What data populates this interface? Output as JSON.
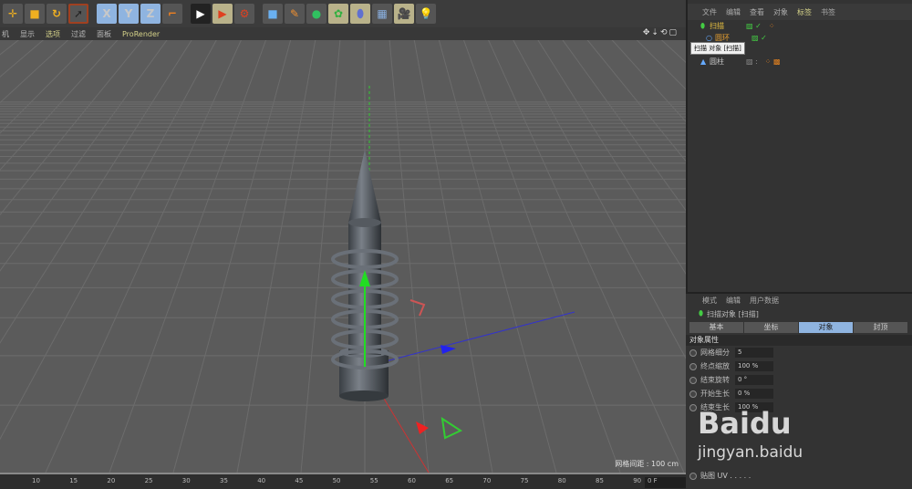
{
  "toolbar": {
    "icons": [
      "move-icon",
      "scale-icon",
      "rotate-icon",
      "select-icon",
      "x-axis-icon",
      "y-axis-icon",
      "z-axis-icon",
      "coord-system-icon",
      "render-view-icon",
      "render-picture-icon",
      "render-settings-icon",
      "cube-icon",
      "pen-icon",
      "subdivision-icon",
      "cloner-icon",
      "deformer-icon",
      "floor-icon",
      "camera-icon",
      "light-icon"
    ],
    "x": "X",
    "y": "Y",
    "z": "Z"
  },
  "viewport_menu": [
    "机",
    "显示",
    "选项",
    "过滤",
    "面板",
    "ProRender"
  ],
  "viewport_grid_label": "网格间距 : 100 cm",
  "timeline": {
    "ticks": [
      "10",
      "15",
      "20",
      "25",
      "30",
      "35",
      "40",
      "45",
      "50",
      "55",
      "60",
      "65",
      "70",
      "75",
      "80",
      "85",
      "90"
    ],
    "frame": "0 F"
  },
  "object_manager": {
    "menu": [
      "文件",
      "编辑",
      "查看",
      "对象",
      "标签",
      "书签"
    ],
    "objects": [
      {
        "name": "扫描"
      },
      {
        "name": "圆环"
      },
      {
        "name": ""
      },
      {
        "name": "圆柱"
      }
    ],
    "tooltip": "扫描 对象 [扫描]"
  },
  "attributes": {
    "menu": [
      "模式",
      "编辑",
      "用户数据"
    ],
    "title": "扫描对象 [扫描]",
    "tabs": [
      "基本",
      "坐标",
      "对象",
      "封顶"
    ],
    "section": "对象属性",
    "props": [
      {
        "label": "网格细分",
        "value": "5"
      },
      {
        "label": "终点缩放",
        "value": "100 %"
      },
      {
        "label": "结束旋转",
        "value": "0 °"
      },
      {
        "label": "开始生长",
        "value": "0 %"
      },
      {
        "label": "结束生长",
        "value": "100 %"
      }
    ],
    "last_label": "贴图 UV . . . . ."
  },
  "watermark": {
    "line1": "Baidu",
    "line2": "jingyan.baidu"
  }
}
